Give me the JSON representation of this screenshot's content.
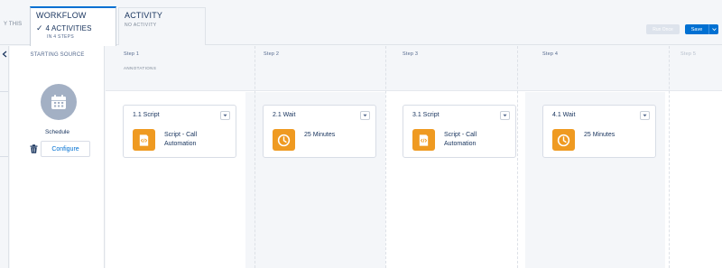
{
  "tabs": {
    "prev_tab_fragment": "Y THIS",
    "workflow": {
      "title": "WORKFLOW",
      "activities": "4 ACTIVITIES",
      "steps": "IN 4 STEPS"
    },
    "activity": {
      "title": "ACTIVITY",
      "subtitle": "NO ACTIVITY"
    }
  },
  "toolbar": {
    "run_label": "Run Once",
    "save_label": "Save"
  },
  "source": {
    "header": "STARTING SOURCE",
    "label": "Schedule",
    "configure_label": "Configure"
  },
  "steps": {
    "annotations_label": "ANNOTATIONS",
    "labels": [
      "Step 1",
      "Step 2",
      "Step 3",
      "Step 4",
      "Step 5"
    ],
    "cards": [
      {
        "title": "1.1 Script",
        "text_line1": "Script - Call",
        "text_line2": "Automation",
        "icon": "script-icon"
      },
      {
        "title": "2.1 Wait",
        "text_line1": "25 Minutes",
        "text_line2": "",
        "icon": "clock-icon"
      },
      {
        "title": "3.1 Script",
        "text_line1": "Script - Call",
        "text_line2": "Automation",
        "icon": "script-icon"
      },
      {
        "title": "4.1 Wait",
        "text_line1": "25 Minutes",
        "text_line2": "",
        "icon": "clock-icon"
      }
    ]
  },
  "colors": {
    "accent": "#0070d2",
    "activity_icon": "#ef9a21",
    "source_icon": "#a3b0c4"
  }
}
